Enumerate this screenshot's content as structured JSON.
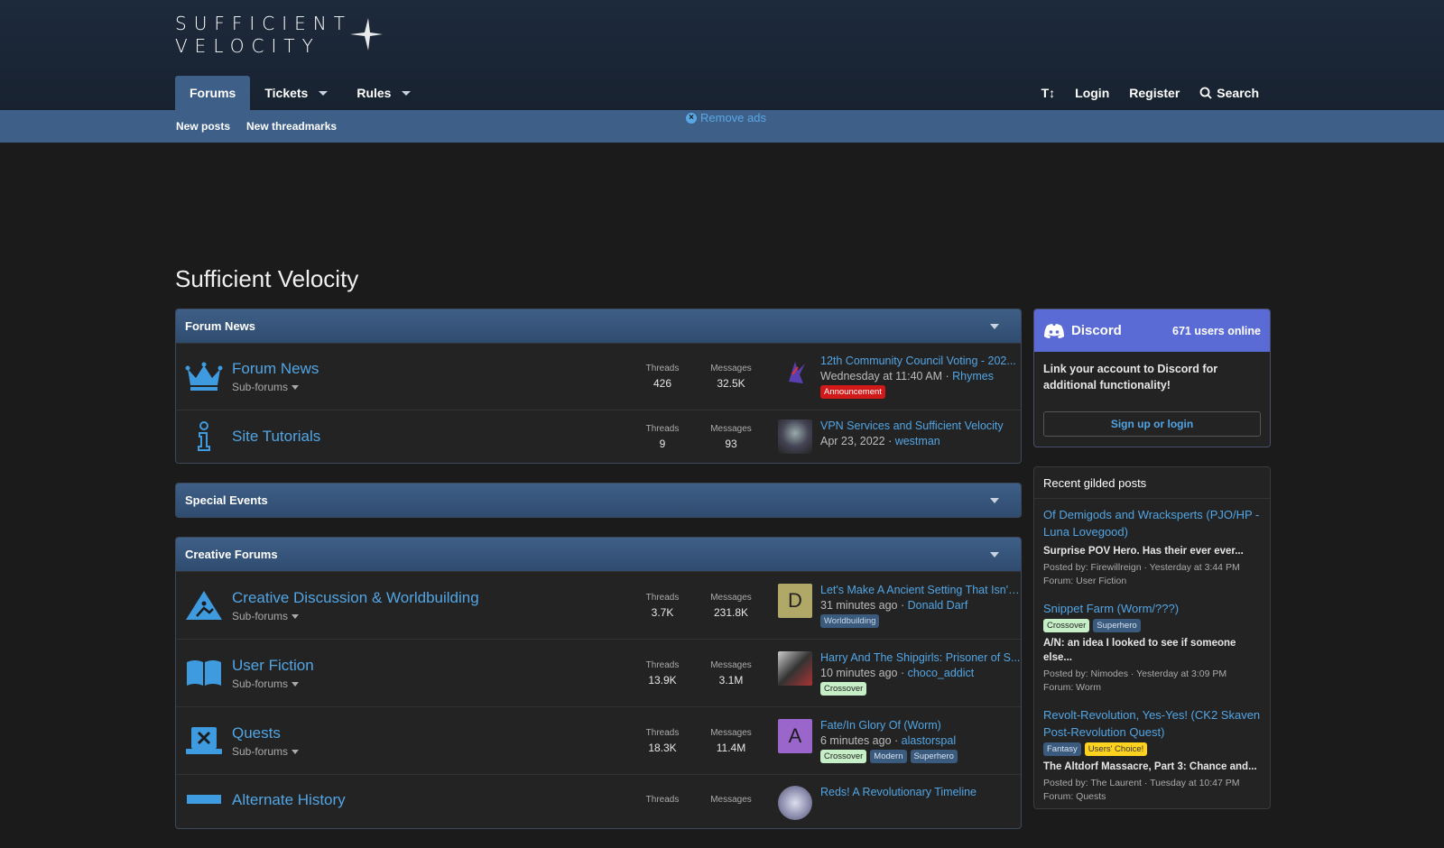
{
  "header": {
    "logo_line1": "SUFFICIENT",
    "logo_line2": "VELOCITY",
    "nav": [
      {
        "label": "Forums",
        "active": true
      },
      {
        "label": "Tickets",
        "active": false
      },
      {
        "label": "Rules",
        "active": false
      }
    ],
    "right": {
      "text_size": "T↕",
      "login": "Login",
      "register": "Register",
      "search": "Search"
    }
  },
  "subnav": {
    "new_posts": "New posts",
    "new_threadmarks": "New threadmarks"
  },
  "remove_ads": "Remove ads",
  "page_title": "Sufficient Velocity",
  "categories": {
    "news": {
      "title": "Forum News",
      "nodes": [
        {
          "title": "Forum News",
          "sub": "Sub-forums",
          "threads_label": "Threads",
          "threads": "426",
          "messages_label": "Messages",
          "messages": "32.5K",
          "last_title": "12th Community Council Voting - 202...",
          "last_time": "Wednesday at 11:40 AM",
          "last_user": "Rhymes",
          "tags": [
            "Announcement"
          ]
        },
        {
          "title": "Site Tutorials",
          "threads_label": "Threads",
          "threads": "9",
          "messages_label": "Messages",
          "messages": "93",
          "last_title": "VPN Services and Sufficient Velocity",
          "last_time": "Apr 23, 2022",
          "last_user": "westman"
        }
      ]
    },
    "events": {
      "title": "Special Events"
    },
    "creative": {
      "title": "Creative Forums",
      "nodes": [
        {
          "title": "Creative Discussion & Worldbuilding",
          "sub": "Sub-forums",
          "threads_label": "Threads",
          "threads": "3.7K",
          "messages_label": "Messages",
          "messages": "231.8K",
          "last_title": "Let's Make A Ancient Setting That Isn't...",
          "last_time": "31 minutes ago",
          "last_user": "Donald Darf",
          "avatar": "D",
          "tags": [
            "Worldbuilding"
          ]
        },
        {
          "title": "User Fiction",
          "sub": "Sub-forums",
          "threads_label": "Threads",
          "threads": "13.9K",
          "messages_label": "Messages",
          "messages": "3.1M",
          "last_title": "Harry And The Shipgirls: Prisoner of S...",
          "last_time": "10 minutes ago",
          "last_user": "choco_addict",
          "tags": [
            "Crossover"
          ]
        },
        {
          "title": "Quests",
          "sub": "Sub-forums",
          "threads_label": "Threads",
          "threads": "18.3K",
          "messages_label": "Messages",
          "messages": "11.4M",
          "last_title": "Fate/In Glory Of (Worm)",
          "last_time": "6 minutes ago",
          "last_user": "alastorspal",
          "avatar": "A",
          "tags": [
            "Crossover",
            "Modern",
            "Superhero"
          ]
        },
        {
          "title": "Alternate History",
          "threads_label": "Threads",
          "messages_label": "Messages",
          "last_title": "Reds! A Revolutionary Timeline"
        }
      ]
    }
  },
  "discord": {
    "brand": "Discord",
    "online": "671 users online",
    "body": "Link your account to Discord for additional functionality!",
    "button": "Sign up or login"
  },
  "gilded": {
    "title": "Recent gilded posts",
    "items": [
      {
        "title": "Of Demigods and Wracksperts (PJO/HP - Luna Lovegood)",
        "excerpt": "Surprise POV Hero. Has their ever ever...",
        "posted": "Posted by: Firewillreign · Yesterday at 3:44 PM",
        "forum": "Forum: User Fiction"
      },
      {
        "title": "Snippet Farm (Worm/???)",
        "tags": [
          "Crossover",
          "Superhero"
        ],
        "excerpt": "A/N: an idea I looked to see if someone else...",
        "posted": "Posted by: Nimodes · Yesterday at 3:09 PM",
        "forum": "Forum: Worm"
      },
      {
        "title": "Revolt-Revolution, Yes-Yes! (CK2 Skaven Post-Revolution Quest)",
        "tags": [
          "Fantasy",
          "Users' Choice!"
        ],
        "excerpt": "The Altdorf Massacre, Part 3: Chance and...",
        "posted": "Posted by: The Laurent · Tuesday at 10:47 PM",
        "forum": "Forum: Quests"
      }
    ]
  }
}
